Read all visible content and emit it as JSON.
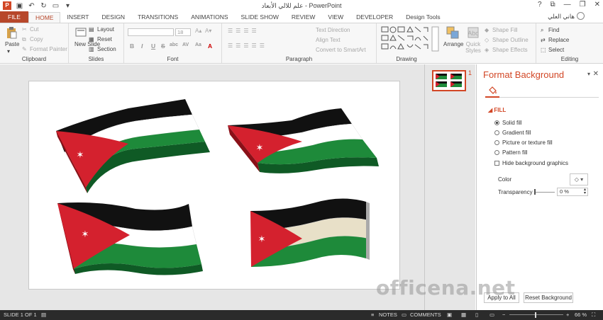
{
  "window": {
    "title": "علم للالي الأبعاد - PowerPoint",
    "app_logo": "P",
    "user": "هاني العلي",
    "controls": [
      "?",
      "⧉",
      "—",
      "❐",
      "✕"
    ]
  },
  "tabs": {
    "file": "FILE",
    "items": [
      "HOME",
      "INSERT",
      "DESIGN",
      "TRANSITIONS",
      "ANIMATIONS",
      "SLIDE SHOW",
      "REVIEW",
      "VIEW",
      "DEVELOPER",
      "Design Tools"
    ],
    "active": "HOME"
  },
  "ribbon": {
    "clipboard": {
      "label": "Clipboard",
      "paste": "Paste",
      "cut": "Cut",
      "copy": "Copy",
      "format_painter": "Format Painter"
    },
    "slides": {
      "label": "Slides",
      "new_slide": "New Slide",
      "layout": "Layout",
      "reset": "Reset",
      "section": "Section"
    },
    "font": {
      "label": "Font",
      "size": "18",
      "bold": "B",
      "italic": "I",
      "underline": "U",
      "strike": "S",
      "shadow": "abc",
      "spacing": "AV",
      "case": "Aa",
      "color": "A"
    },
    "paragraph": {
      "label": "Paragraph",
      "text_direction": "Text Direction",
      "align_text": "Align Text",
      "convert_smartart": "Convert to SmartArt"
    },
    "drawing": {
      "label": "Drawing",
      "arrange": "Arrange",
      "quick_styles": "Quick Styles",
      "shape_fill": "Shape Fill",
      "shape_outline": "Shape Outline",
      "shape_effects": "Shape Effects"
    },
    "editing": {
      "label": "Editing",
      "find": "Find",
      "replace": "Replace",
      "select": "Select"
    }
  },
  "thumbnails": {
    "number": "1"
  },
  "format_pane": {
    "title": "Format Background",
    "section": "FILL",
    "options": [
      {
        "label": "Solid fill",
        "selected": true
      },
      {
        "label": "Gradient fill",
        "selected": false
      },
      {
        "label": "Picture or texture fill",
        "selected": false
      },
      {
        "label": "Pattern fill",
        "selected": false
      }
    ],
    "hide_bg": "Hide background graphics",
    "color_label": "Color",
    "transparency_label": "Transparency",
    "transparency_value": "0 %",
    "apply_all": "Apply to All",
    "reset_bg": "Reset Background"
  },
  "watermark": "officena.net",
  "status": {
    "slide_info": "SLIDE 1 OF 1",
    "notes": "NOTES",
    "comments": "COMMENTS",
    "zoom": "66 %"
  },
  "colors": {
    "accent": "#d24726",
    "flag_black": "#111111",
    "flag_white": "#ffffff",
    "flag_green": "#1e8a3a",
    "flag_red": "#d4212e"
  }
}
